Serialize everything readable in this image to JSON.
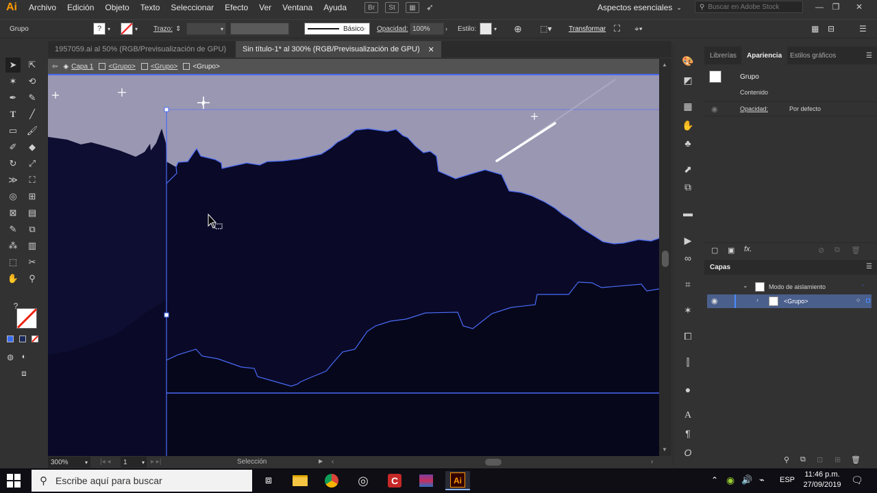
{
  "menubar": {
    "logo": "Ai",
    "items": [
      "Archivo",
      "Edición",
      "Objeto",
      "Texto",
      "Seleccionar",
      "Efecto",
      "Ver",
      "Ventana",
      "Ayuda"
    ],
    "icons": [
      "bridge-icon",
      "stock-icon",
      "arrange-icon",
      "gpu-performance-icon"
    ],
    "workspace": "Aspectos esenciales",
    "stock_search_placeholder": "Buscar en Adobe Stock"
  },
  "controlbar": {
    "selection_label": "Grupo",
    "stroke_label": "Trazo:",
    "brush_label": "Básico",
    "opacity_label": "Opacidad:",
    "opacity_value": "100%",
    "style_label": "Estilo:",
    "transform_label": "Transformar"
  },
  "tabs": [
    {
      "label": "1957059.ai al 50% (RGB/Previsualización de GPU)",
      "active": false
    },
    {
      "label": "Sin título-1* al 300% (RGB/Previsualización de GPU)",
      "active": true
    }
  ],
  "breadcrumb": [
    "Capa 1",
    "<Grupo>",
    "<Grupo>",
    "<Grupo>"
  ],
  "canvas": {
    "sky_color": "#9a97b3",
    "mountain_color": "#0a0a28",
    "selection_color": "#4a6cf7"
  },
  "statusbar": {
    "zoom": "300%",
    "artboard": "1",
    "tool_label": "Selección"
  },
  "appearance": {
    "tabs": [
      "Librerías",
      "Apariencia",
      "Estilos gráficos"
    ],
    "active_tab": "Apariencia",
    "object_name": "Grupo",
    "content_label": "Contenido",
    "opacity_label": "Opacidad:",
    "opacity_value": "Por defecto"
  },
  "layers": {
    "title": "Capas",
    "rows": [
      {
        "name": "Modo de aislamiento"
      },
      {
        "name": "<Grupo>"
      }
    ]
  },
  "taskbar": {
    "search_placeholder": "Escribe aquí para buscar",
    "language": "ESP",
    "time": "11:46 p.m.",
    "date": "27/09/2019"
  }
}
